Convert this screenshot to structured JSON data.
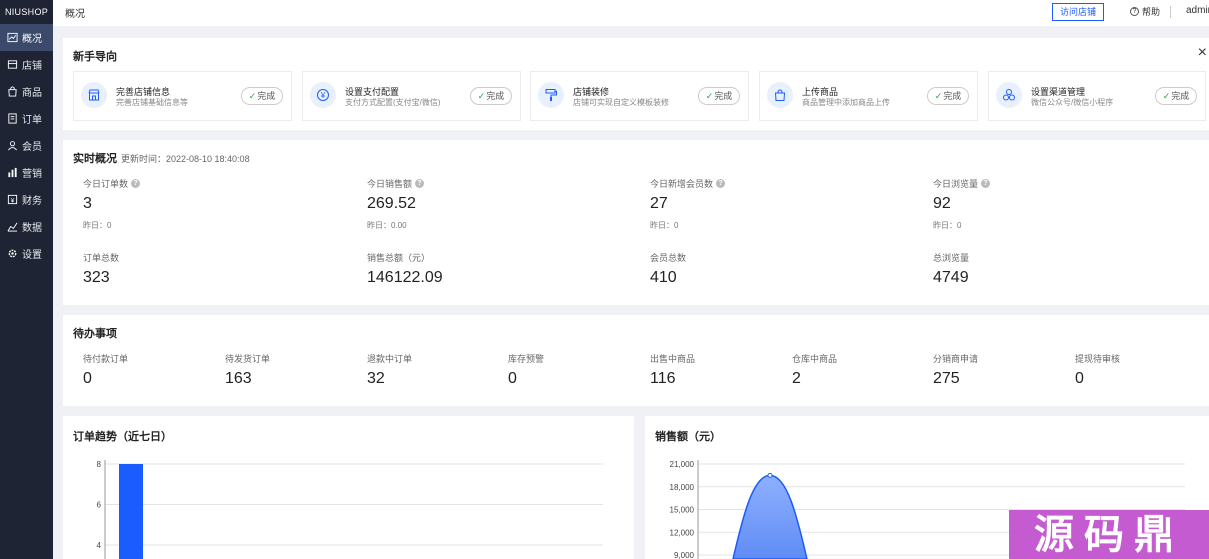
{
  "sidebar": {
    "logo": "NIUSHOP",
    "items": [
      {
        "label": "概况",
        "icon": "chart-line-icon"
      },
      {
        "label": "店铺",
        "icon": "store-icon"
      },
      {
        "label": "商品",
        "icon": "bag-icon"
      },
      {
        "label": "订单",
        "icon": "order-icon"
      },
      {
        "label": "会员",
        "icon": "user-icon"
      },
      {
        "label": "营销",
        "icon": "bars-icon"
      },
      {
        "label": "财务",
        "icon": "wallet-icon"
      },
      {
        "label": "数据",
        "icon": "data-icon"
      },
      {
        "label": "设置",
        "icon": "gear-icon"
      }
    ]
  },
  "header": {
    "breadcrumb": "概况",
    "visit_store": "访问店铺",
    "help": "帮助",
    "admin": "admin"
  },
  "guide": {
    "title": "新手导向",
    "close": "×",
    "done_label": "完成",
    "items": [
      {
        "title": "完善店铺信息",
        "desc": "完善店铺基础信息等",
        "icon": "store-icon"
      },
      {
        "title": "设置支付配置",
        "desc": "支付方式配置(支付宝/微信)",
        "icon": "yen-icon"
      },
      {
        "title": "店铺装修",
        "desc": "店铺可实现自定义模板装修",
        "icon": "paint-roller-icon"
      },
      {
        "title": "上传商品",
        "desc": "商品管理中添加商品上传",
        "icon": "bag-icon"
      },
      {
        "title": "设置渠道管理",
        "desc": "微信公众号/微信小程序",
        "icon": "channel-icon"
      }
    ]
  },
  "realtime": {
    "title": "实时概况",
    "update_time": "更新时间：2022-08-10 18:40:08",
    "today": [
      {
        "label": "今日订单数",
        "value": "3",
        "yesterday": "昨日：0"
      },
      {
        "label": "今日销售额",
        "value": "269.52",
        "yesterday": "昨日：0.00"
      },
      {
        "label": "今日新增会员数",
        "value": "27",
        "yesterday": "昨日：0"
      },
      {
        "label": "今日浏览量",
        "value": "92",
        "yesterday": "昨日：0"
      }
    ],
    "totals": [
      {
        "label": "订单总数",
        "value": "323"
      },
      {
        "label": "销售总额（元）",
        "value": "146122.09"
      },
      {
        "label": "会员总数",
        "value": "410"
      },
      {
        "label": "总浏览量",
        "value": "4749"
      }
    ]
  },
  "todo": {
    "title": "待办事项",
    "items": [
      {
        "label": "待付款订单",
        "value": "0"
      },
      {
        "label": "待发货订单",
        "value": "163"
      },
      {
        "label": "退款中订单",
        "value": "32"
      },
      {
        "label": "库存预警",
        "value": "0"
      },
      {
        "label": "出售中商品",
        "value": "116"
      },
      {
        "label": "仓库中商品",
        "value": "2"
      },
      {
        "label": "分销商申请",
        "value": "275"
      },
      {
        "label": "提现待审核",
        "value": "0"
      }
    ]
  },
  "chart_data": [
    {
      "type": "bar",
      "title": "订单趋势（近七日）",
      "y_ticks": [
        "8",
        "6",
        "4"
      ],
      "ylim": [
        0,
        8
      ],
      "visible_y_range": [
        3.4,
        8
      ],
      "grid": true,
      "color": "#1a5cff",
      "series": [
        {
          "values": [
            8
          ]
        }
      ]
    },
    {
      "type": "area",
      "title": "销售额（元）",
      "y_ticks": [
        "21,000",
        "18,000",
        "15,000",
        "12,000",
        "9,000"
      ],
      "ylim": [
        0,
        21000
      ],
      "visible_y_range": [
        8500,
        21000
      ],
      "grid": true,
      "color": "#1a5cff",
      "peak": 19500
    }
  ],
  "watermark": "源码鼎"
}
